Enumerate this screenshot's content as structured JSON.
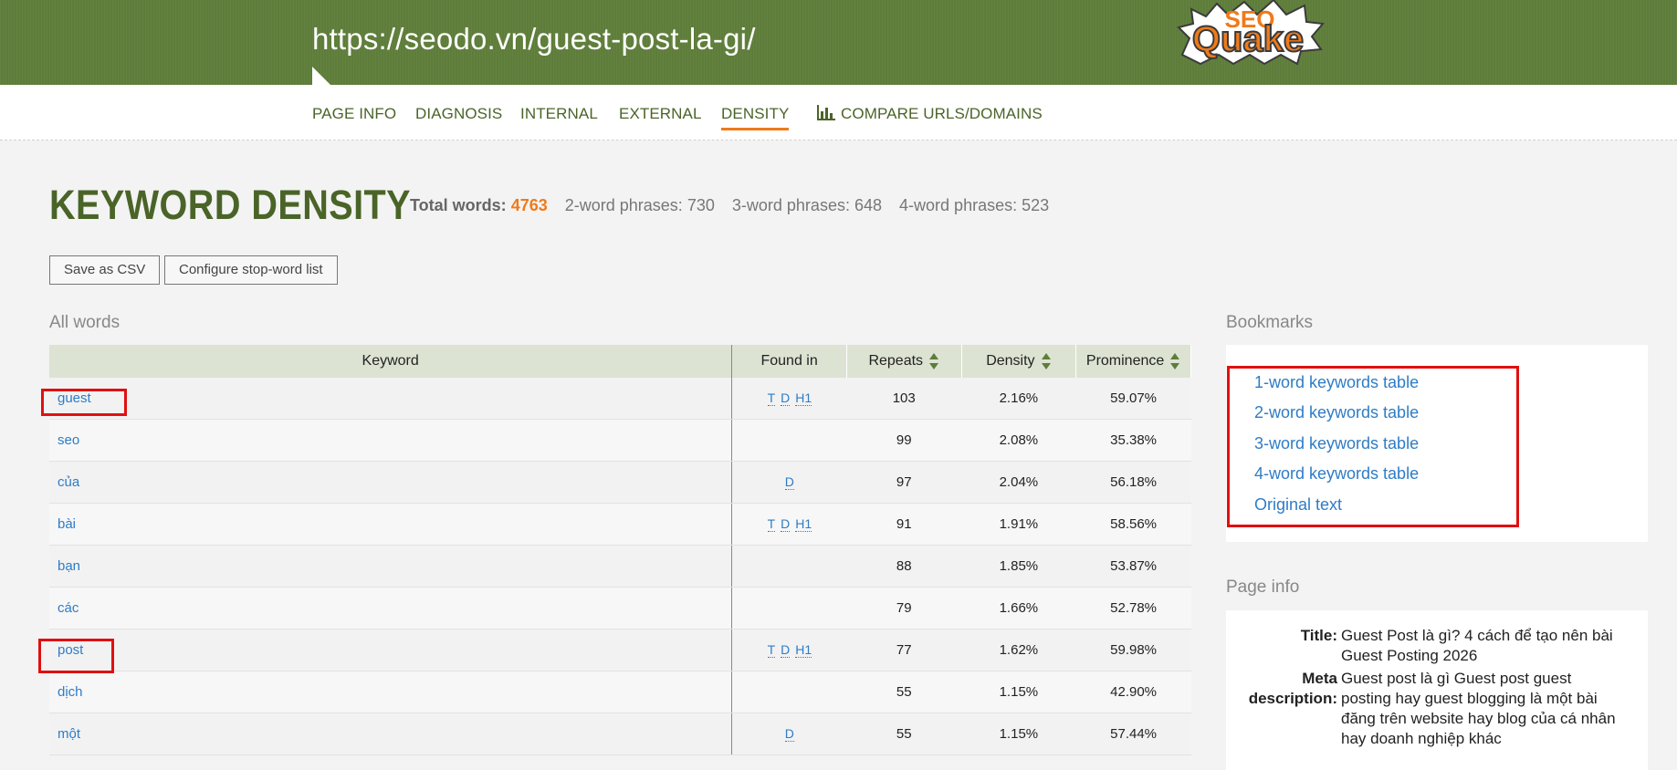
{
  "header": {
    "url": "https://seodo.vn/guest-post-la-gi/",
    "logo_text": "Quake"
  },
  "nav": {
    "items": [
      {
        "label": "PAGE INFO"
      },
      {
        "label": "DIAGNOSIS"
      },
      {
        "label": "INTERNAL"
      },
      {
        "label": "EXTERNAL"
      },
      {
        "label": "DENSITY",
        "active": true
      },
      {
        "label": "COMPARE URLS/DOMAINS",
        "icon": "bar-chart-icon"
      }
    ]
  },
  "title": "KEYWORD DENSITY",
  "stats": {
    "total_words_label": "Total words:",
    "total_words_value": "4763",
    "two_word_label": "2-word phrases:",
    "two_word_value": "730",
    "three_word_label": "3-word phrases:",
    "three_word_value": "648",
    "four_word_label": "4-word phrases:",
    "four_word_value": "523"
  },
  "buttons": {
    "save_csv": "Save as CSV",
    "configure_stop_words": "Configure stop-word list"
  },
  "all_words": {
    "label": "All words",
    "columns": [
      "Keyword",
      "Found in",
      "Repeats",
      "Density",
      "Prominence"
    ],
    "rows": [
      {
        "keyword": "guest",
        "found_in": [
          "T",
          "D",
          "H1"
        ],
        "repeats": "103",
        "density": "2.16%",
        "prominence": "59.07%"
      },
      {
        "keyword": "seo",
        "found_in": [],
        "repeats": "99",
        "density": "2.08%",
        "prominence": "35.38%"
      },
      {
        "keyword": "của",
        "found_in": [
          "D"
        ],
        "repeats": "97",
        "density": "2.04%",
        "prominence": "56.18%"
      },
      {
        "keyword": "bài",
        "found_in": [
          "T",
          "D",
          "H1"
        ],
        "repeats": "91",
        "density": "1.91%",
        "prominence": "58.56%"
      },
      {
        "keyword": "bạn",
        "found_in": [],
        "repeats": "88",
        "density": "1.85%",
        "prominence": "53.87%"
      },
      {
        "keyword": "các",
        "found_in": [],
        "repeats": "79",
        "density": "1.66%",
        "prominence": "52.78%"
      },
      {
        "keyword": "post",
        "found_in": [
          "T",
          "D",
          "H1"
        ],
        "repeats": "77",
        "density": "1.62%",
        "prominence": "59.98%"
      },
      {
        "keyword": "dịch",
        "found_in": [],
        "repeats": "55",
        "density": "1.15%",
        "prominence": "42.90%"
      },
      {
        "keyword": "một",
        "found_in": [
          "D"
        ],
        "repeats": "55",
        "density": "1.15%",
        "prominence": "57.44%"
      }
    ]
  },
  "bookmarks": {
    "label": "Bookmarks",
    "links": [
      "1-word keywords table",
      "2-word keywords table",
      "3-word keywords table",
      "4-word keywords table",
      "Original text"
    ]
  },
  "page_info": {
    "label": "Page info",
    "title_key": "Title:",
    "title_lines": [
      "Guest Post là gì? 4 cách để tạo nên bài",
      "Guest Posting 2026"
    ],
    "meta_key_lines": [
      "Meta",
      "description:"
    ],
    "meta_lines": [
      "Guest post là gì Guest post guest",
      "posting hay guest blogging là một bài",
      "đăng trên website hay blog của cá nhân",
      "hay doanh nghiệp khác"
    ]
  },
  "colors": {
    "header_green": "#5e7d3a",
    "nav_green": "#4a6428",
    "accent_orange": "#f07a1a",
    "link_blue": "#2e7cc6",
    "highlight_red": "#e01010"
  }
}
